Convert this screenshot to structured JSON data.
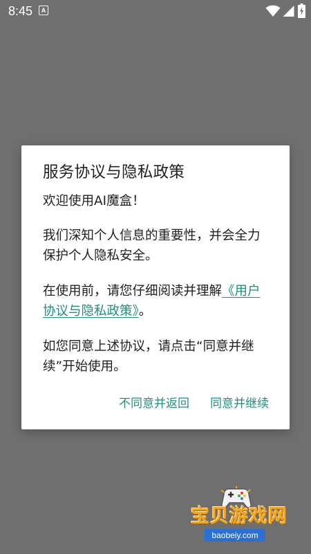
{
  "status_bar": {
    "time": "8:45",
    "notification_icon_letter": "A",
    "icons": [
      "a-notification-icon",
      "wifi-icon",
      "cell-signal-icon",
      "battery-icon"
    ]
  },
  "dialog": {
    "title": "服务协议与隐私政策",
    "welcome": "欢迎使用AI魔盒！",
    "paragraph_importance": "我们深知个人信息的重要性，并会全力保护个人隐私安全。",
    "paragraph_read_prefix": "在使用前，请您仔细阅读并理解",
    "policy_link_text": "《用户协议与隐私政策》",
    "paragraph_read_suffix": "。",
    "paragraph_agree": "如您同意上述协议，请点击“同意并继续”开始使用。",
    "decline_button": "不同意并返回",
    "accept_button": "同意并继续"
  },
  "watermark": {
    "title": "宝贝游戏网",
    "url": "baobeiy.com"
  },
  "colors": {
    "scrim": "#6f6f6f",
    "dialog_bg": "#ffffff",
    "accent": "#1f8f80",
    "text": "#212121"
  }
}
